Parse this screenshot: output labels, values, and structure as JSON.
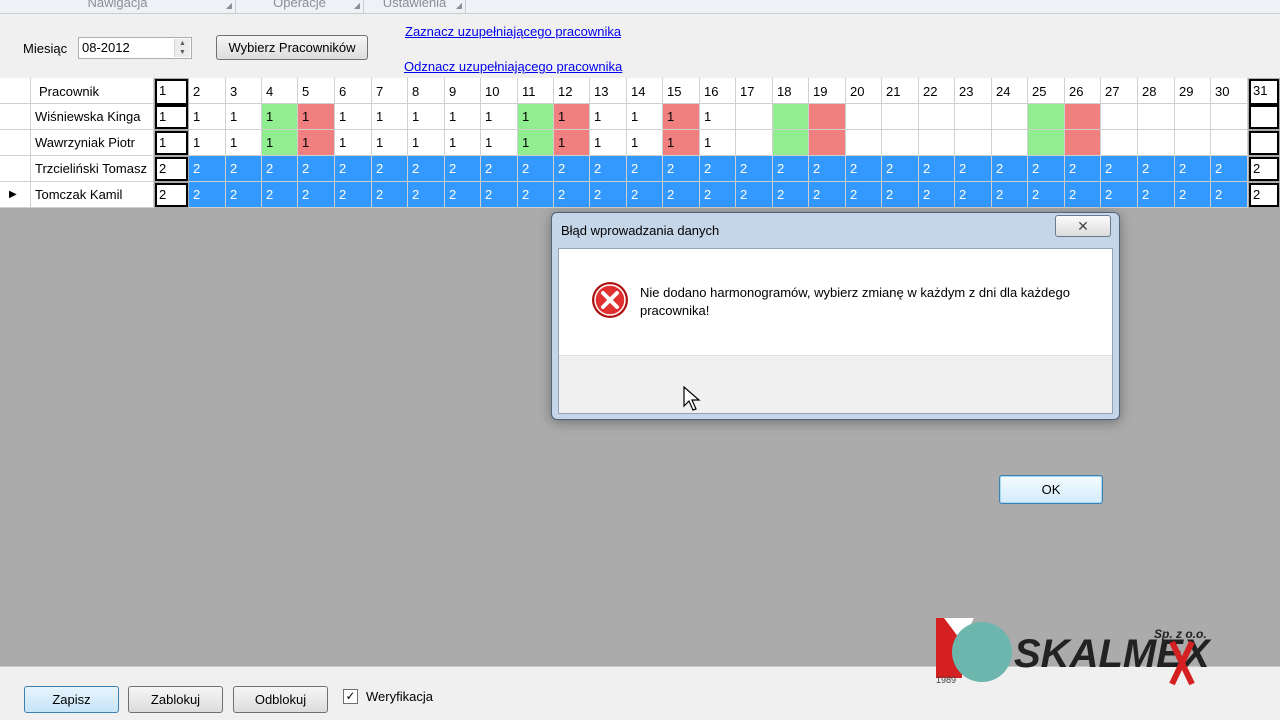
{
  "ribbon": {
    "groups": [
      "Nawigacja",
      "Operacje",
      "Ustawienia"
    ]
  },
  "top": {
    "month_label": "Miesiąc",
    "month_value": "08-2012",
    "select_employees_button": "Wybierz Pracowników",
    "link_mark": "Zaznacz uzupełniającego pracownika",
    "link_unmark": "Odznacz uzupełniającego pracownika"
  },
  "grid": {
    "employee_header": "Pracownik",
    "day_headers": [
      "1",
      "2",
      "3",
      "4",
      "5",
      "6",
      "7",
      "8",
      "9",
      "10",
      "11",
      "12",
      "13",
      "14",
      "15",
      "16",
      "17",
      "18",
      "19",
      "20",
      "21",
      "22",
      "23",
      "24",
      "25",
      "26",
      "27",
      "28",
      "29",
      "30",
      "31"
    ],
    "rows": [
      {
        "name": "Wiśniewska Kinga",
        "cells": [
          "1",
          "1",
          "1",
          "1",
          "1",
          "1",
          "1",
          "1",
          "1",
          "1",
          "1",
          "1",
          "1",
          "1",
          "1",
          "1",
          "",
          "",
          "",
          "",
          "",
          "",
          "",
          "",
          "",
          "",
          "",
          "",
          "",
          "",
          ""
        ]
      },
      {
        "name": "Wawrzyniak Piotr",
        "cells": [
          "1",
          "1",
          "1",
          "1",
          "1",
          "1",
          "1",
          "1",
          "1",
          "1",
          "1",
          "1",
          "1",
          "1",
          "1",
          "1",
          "",
          "",
          "",
          "",
          "",
          "",
          "",
          "",
          "",
          "",
          "",
          "",
          "",
          "",
          ""
        ]
      },
      {
        "name": "Trzcieliński Tomasz",
        "cells": [
          "2",
          "2",
          "2",
          "2",
          "2",
          "2",
          "2",
          "2",
          "2",
          "2",
          "2",
          "2",
          "2",
          "2",
          "2",
          "2",
          "2",
          "2",
          "2",
          "2",
          "2",
          "2",
          "2",
          "2",
          "2",
          "2",
          "2",
          "2",
          "2",
          "2",
          "2"
        ]
      },
      {
        "name": "Tomczak Kamil",
        "cells": [
          "2",
          "2",
          "2",
          "2",
          "2",
          "2",
          "2",
          "2",
          "2",
          "2",
          "2",
          "2",
          "2",
          "2",
          "2",
          "2",
          "2",
          "2",
          "2",
          "2",
          "2",
          "2",
          "2",
          "2",
          "2",
          "2",
          "2",
          "2",
          "2",
          "2",
          "2"
        ]
      }
    ],
    "green_days": [
      4,
      11,
      18,
      25
    ],
    "red_days": [
      5,
      12,
      15,
      19,
      26
    ],
    "selected_rows": [
      2,
      3
    ],
    "current_row": 3,
    "colors": {
      "green": "#90ee90",
      "red": "#f08080",
      "selected": "#3399ff"
    }
  },
  "bottom": {
    "save_button": "Zapisz",
    "lock_button": "Zablokuj",
    "unlock_button": "Odblokuj",
    "verification_label": "Weryfikacja",
    "verification_checked": true
  },
  "logo": {
    "company": "SKALMEX",
    "suffix": "Sp. z o.o.",
    "year": "1989"
  },
  "dialog": {
    "title": "Błąd wprowadzania danych",
    "message": "Nie dodano harmonogramów, wybierz zmianę w każdym z dni dla każdego pracownika!",
    "ok_button": "OK",
    "close_glyph": "✕",
    "icon": "error-icon"
  }
}
